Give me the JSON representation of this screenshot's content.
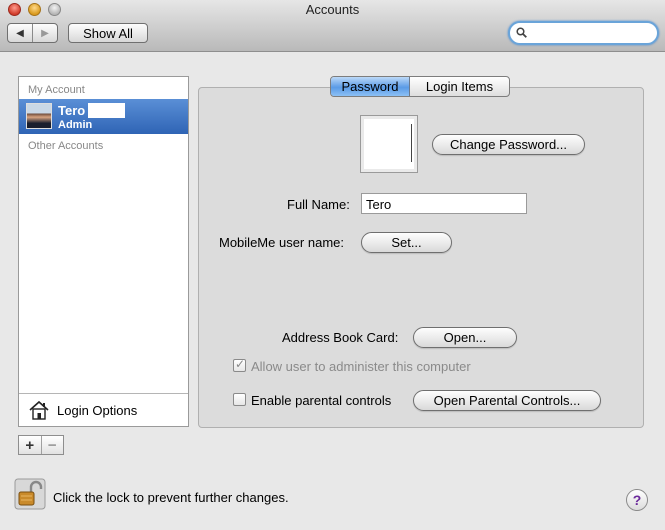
{
  "window": {
    "title": "Accounts"
  },
  "toolbar": {
    "back_icon": "◀",
    "forward_icon": "▶",
    "show_all_label": "Show All",
    "search_placeholder": "",
    "search_value": ""
  },
  "sidebar": {
    "my_account_header": "My Account",
    "accounts": [
      {
        "name": "Tero",
        "role": "Admin"
      }
    ],
    "other_accounts_header": "Other Accounts",
    "login_options_label": "Login Options",
    "add_label": "+",
    "remove_label": "−"
  },
  "tabs": [
    {
      "label": "Password",
      "active": true
    },
    {
      "label": "Login Items",
      "active": false
    }
  ],
  "password_pane": {
    "change_password_label": "Change Password...",
    "full_name_label": "Full Name:",
    "full_name_value": "Tero",
    "mobileme_label": "MobileMe user name:",
    "set_label": "Set...",
    "address_book_label": "Address Book Card:",
    "open_label": "Open...",
    "allow_admin_label": "Allow user to administer this computer",
    "allow_admin_checked": true,
    "allow_admin_enabled": false,
    "parental_label": "Enable parental controls",
    "parental_checked": false,
    "open_parental_label": "Open Parental Controls..."
  },
  "footer": {
    "lock_label": "Click the lock to prevent further changes.",
    "help_label": "?"
  },
  "colors": {
    "selection": "#3a6fc0",
    "tab_active": "#6aa8ee",
    "search_focus": "#6aa4d9"
  }
}
